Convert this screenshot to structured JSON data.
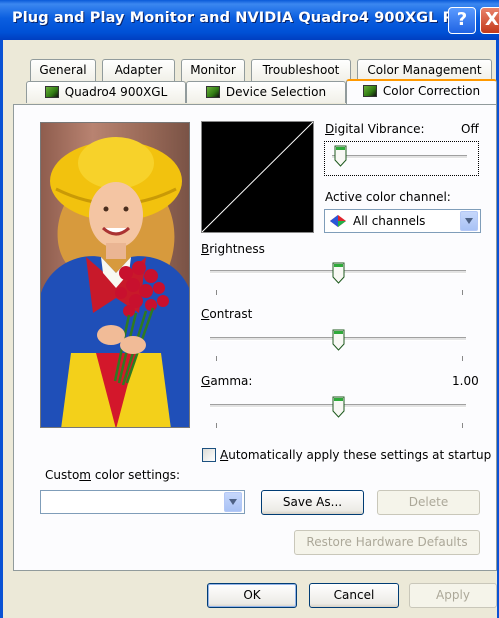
{
  "window": {
    "title": "Plug and Play Monitor and NVIDIA Quadro4 900XGL P...",
    "help_label": "?",
    "close_label": "X"
  },
  "tabs_row1": [
    {
      "label": "General"
    },
    {
      "label": "Adapter"
    },
    {
      "label": "Monitor"
    },
    {
      "label": "Troubleshoot"
    },
    {
      "label": "Color Management"
    }
  ],
  "tabs_row2": [
    {
      "label": "Quadro4 900XGL"
    },
    {
      "label": "Device Selection"
    },
    {
      "label": "Color Correction",
      "active": true
    }
  ],
  "digital_vibrance": {
    "label_prefix": "D",
    "label_rest": "igital Vibrance:",
    "value": "Off",
    "level": 0
  },
  "active_channel": {
    "label": "Active color channel:",
    "selected": "All channels"
  },
  "brightness": {
    "label_prefix": "B",
    "label_rest": "rightness",
    "level": 0.5
  },
  "contrast": {
    "label_prefix": "C",
    "label_rest": "ontrast",
    "level": 0.5
  },
  "gamma": {
    "label_prefix": "G",
    "label_rest": "amma:",
    "value": "1.00",
    "level": 0.5
  },
  "auto_apply": {
    "label_pre": "A",
    "label_rest": "utomatically apply these settings at startup",
    "checked": false
  },
  "custom": {
    "label_a": "Custo",
    "label_u": "m",
    "label_b": " color settings:",
    "value": ""
  },
  "buttons": {
    "save_as": "Save As...",
    "delete": "Delete",
    "restore": "Restore Hardware Defaults",
    "ok": "OK",
    "cancel": "Cancel",
    "apply": "Apply"
  },
  "colors": {
    "title_bar": "#0054e3",
    "active_tab_accent": "#ff9900",
    "thumb_green": "#2faa3a"
  }
}
